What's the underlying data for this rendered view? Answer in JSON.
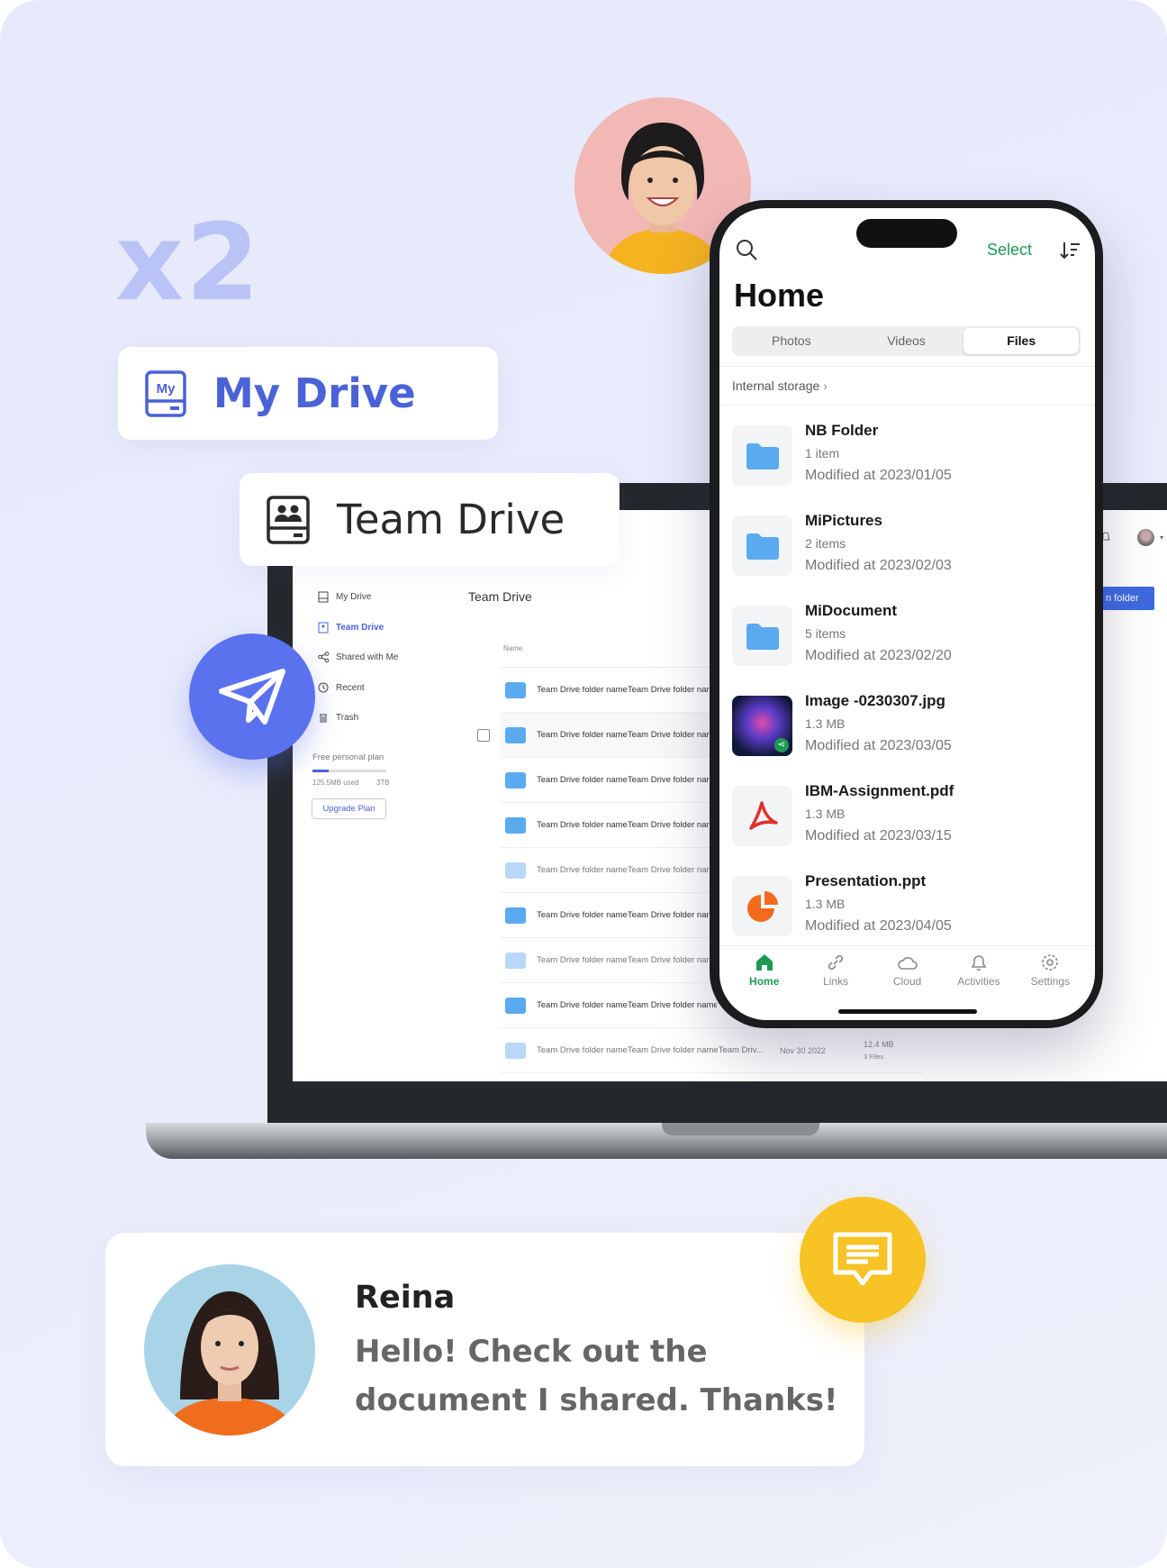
{
  "hero": {
    "multiplier": "x2"
  },
  "cards": {
    "my_drive": {
      "label": "My Drive",
      "icon": "my-drive-icon",
      "icon_text": "My"
    },
    "team_drive": {
      "label": "Team Drive",
      "icon": "team-drive-icon"
    }
  },
  "laptop": {
    "sidebar": {
      "items": [
        {
          "label": "My Drive",
          "icon": "my-drive-icon"
        },
        {
          "label": "Team Drive",
          "icon": "team-drive-icon",
          "active": true
        },
        {
          "label": "Shared with Me",
          "icon": "share-icon"
        },
        {
          "label": "Recent",
          "icon": "clock-icon"
        },
        {
          "label": "Trash",
          "icon": "trash-icon"
        }
      ],
      "plan": {
        "label": "Free personal plan",
        "used": "125.5MB used",
        "total": "3TB",
        "usage_fraction": 0.1,
        "upgrade_label": "Upgrade Plan"
      }
    },
    "title": "Team Drive",
    "column_name": "Name",
    "new_folder_label": "n folder",
    "rows": [
      {
        "name": "Team Drive folder nameTeam Drive folder nar",
        "faded": false
      },
      {
        "name": "Team Drive folder nameTeam Drive folder nar",
        "faded": false,
        "checkbox": true
      },
      {
        "name": "Team Drive folder nameTeam Drive folder nar",
        "faded": false
      },
      {
        "name": "Team Drive folder nameTeam Drive folder nar",
        "faded": false
      },
      {
        "name": "Team Drive folder nameTeam Drive folder nar",
        "faded": true
      },
      {
        "name": "Team Drive folder nameTeam Drive folder nar",
        "faded": false
      },
      {
        "name": "Team Drive folder nameTeam Drive folder nar",
        "faded": true
      },
      {
        "name": "Team Drive folder nameTeam Drive folder name",
        "faded": false
      },
      {
        "name": "Team Drive folder nameTeam Drive folder nameTeam Driv...",
        "faded": true,
        "date": "Nov 30 2022",
        "size": "12.4 MB",
        "files": "3 Files"
      }
    ]
  },
  "phone": {
    "select_label": "Select",
    "title": "Home",
    "tabs": [
      {
        "label": "Photos"
      },
      {
        "label": "Videos"
      },
      {
        "label": "Files",
        "selected": true
      }
    ],
    "breadcrumb": "Internal storage",
    "items": [
      {
        "name": "NB Folder",
        "sub": "1 item",
        "modified": "Modified at 2023/01/05",
        "type": "folder"
      },
      {
        "name": "MiPictures",
        "sub": "2 items",
        "modified": "Modified at 2023/02/03",
        "type": "folder"
      },
      {
        "name": "MiDocument",
        "sub": "5 items",
        "modified": "Modified at 2023/02/20",
        "type": "folder"
      },
      {
        "name": "Image -0230307.jpg",
        "sub": "1.3 MB",
        "modified": "Modified at 2023/03/05",
        "type": "image"
      },
      {
        "name": "IBM-Assignment.pdf",
        "sub": "1.3 MB",
        "modified": "Modified at 2023/03/15",
        "type": "pdf"
      },
      {
        "name": "Presentation.ppt",
        "sub": "1.3 MB",
        "modified": "Modified at 2023/04/05",
        "type": "ppt"
      }
    ],
    "nav": [
      {
        "label": "Home",
        "icon": "home-icon",
        "active": true
      },
      {
        "label": "Links",
        "icon": "link-icon"
      },
      {
        "label": "Cloud",
        "icon": "cloud-icon"
      },
      {
        "label": "Activities",
        "icon": "bell-icon"
      },
      {
        "label": "Settings",
        "icon": "gear-icon"
      }
    ],
    "accent": "#1e9a55"
  },
  "chat": {
    "name": "Reina",
    "message": "Hello! Check out the document I shared. Thanks!"
  },
  "colors": {
    "brand": "#4a62d8",
    "plane_circle": "#5b72ee",
    "chat_badge": "#f7c325"
  }
}
